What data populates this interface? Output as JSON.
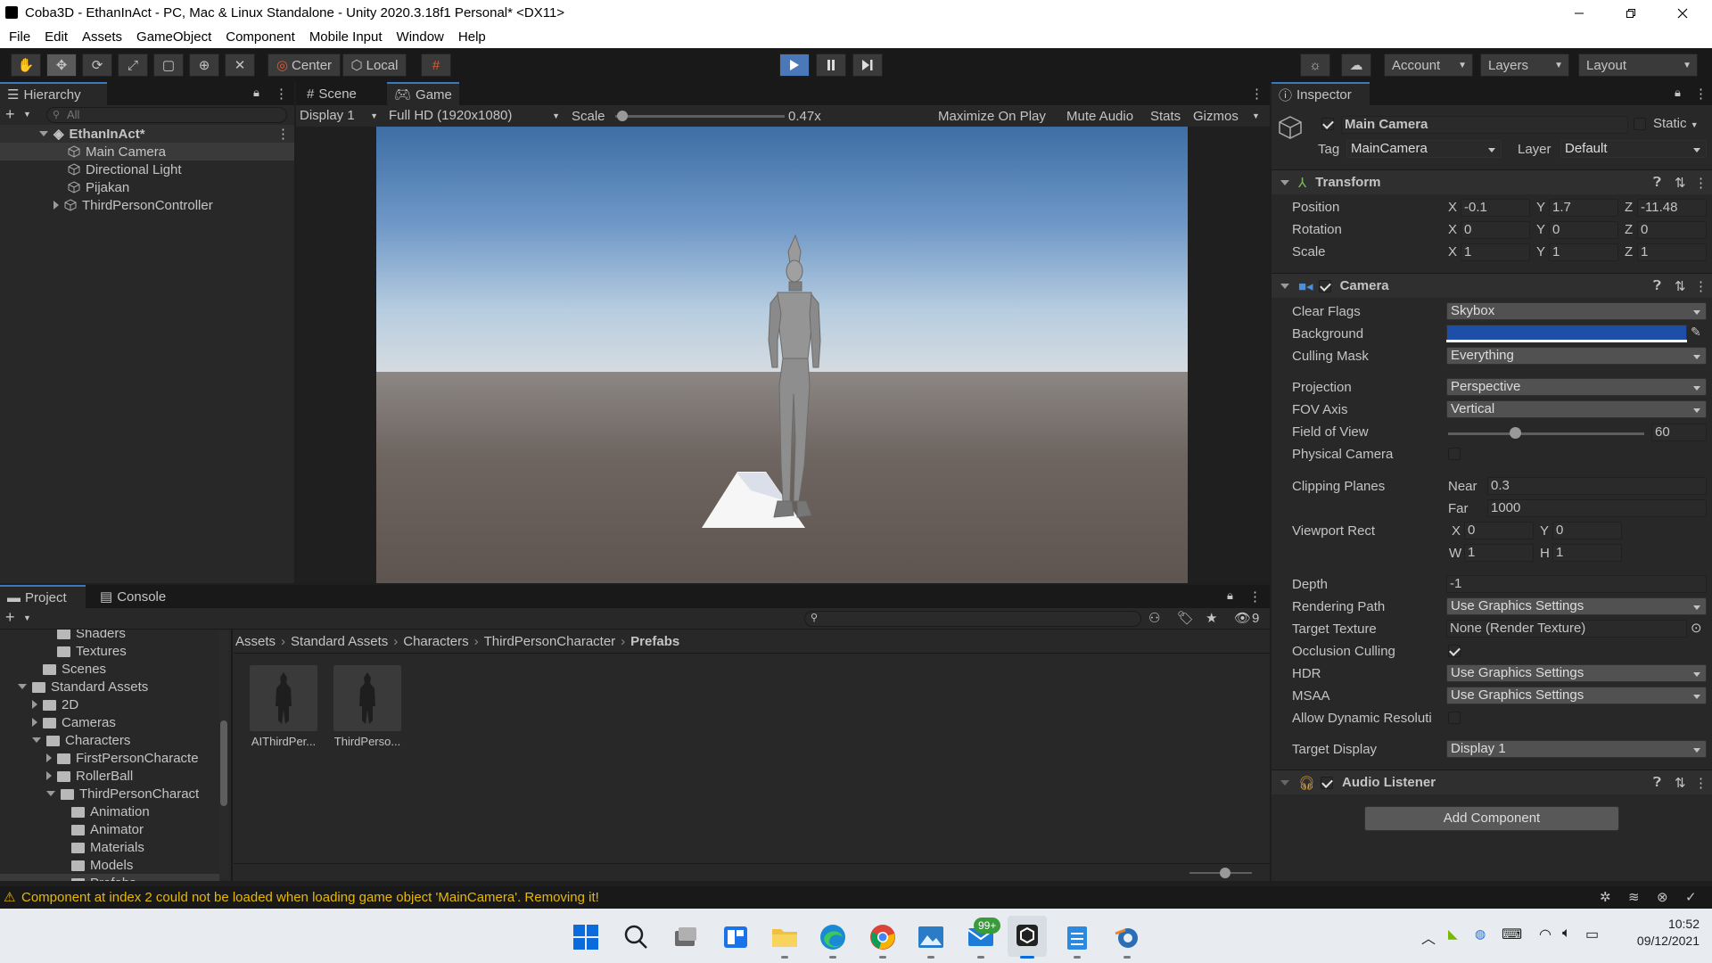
{
  "window": {
    "title": "Coba3D - EthanInAct - PC, Mac & Linux Standalone - Unity 2020.3.18f1 Personal* <DX11>"
  },
  "menu": [
    "File",
    "Edit",
    "Assets",
    "GameObject",
    "Component",
    "Mobile Input",
    "Window",
    "Help"
  ],
  "toolbar": {
    "pivot": "Center",
    "space": "Local",
    "account": "Account",
    "layers": "Layers",
    "layout": "Layout"
  },
  "hierarchy": {
    "tab": "Hierarchy",
    "search_placeholder": "All",
    "scene": "EthanInAct*",
    "items": [
      "Main Camera",
      "Directional Light",
      "Pijakan",
      "ThirdPersonController"
    ]
  },
  "view_tabs": {
    "scene": "Scene",
    "game": "Game"
  },
  "game_bar": {
    "display": "Display 1",
    "resolution": "Full HD (1920x1080)",
    "scale_label": "Scale",
    "scale_value": "0.47x",
    "maximize": "Maximize On Play",
    "mute": "Mute Audio",
    "stats": "Stats",
    "gizmos": "Gizmos"
  },
  "project": {
    "tabs": {
      "project": "Project",
      "console": "Console"
    },
    "filter_count": "9",
    "tree": [
      {
        "label": "Shaders",
        "indent": 3,
        "arrow": "none"
      },
      {
        "label": "Textures",
        "indent": 3,
        "arrow": "none"
      },
      {
        "label": "Scenes",
        "indent": 2,
        "arrow": "none"
      },
      {
        "label": "Standard Assets",
        "indent": 1,
        "arrow": "down"
      },
      {
        "label": "2D",
        "indent": 2,
        "arrow": "right"
      },
      {
        "label": "Cameras",
        "indent": 2,
        "arrow": "right"
      },
      {
        "label": "Characters",
        "indent": 2,
        "arrow": "down"
      },
      {
        "label": "FirstPersonCharacte",
        "indent": 3,
        "arrow": "right"
      },
      {
        "label": "RollerBall",
        "indent": 3,
        "arrow": "right"
      },
      {
        "label": "ThirdPersonCharact",
        "indent": 3,
        "arrow": "down"
      },
      {
        "label": "Animation",
        "indent": 4,
        "arrow": "none"
      },
      {
        "label": "Animator",
        "indent": 4,
        "arrow": "none"
      },
      {
        "label": "Materials",
        "indent": 4,
        "arrow": "none"
      },
      {
        "label": "Models",
        "indent": 4,
        "arrow": "none"
      },
      {
        "label": "Prefabs",
        "indent": 4,
        "arrow": "none"
      }
    ],
    "breadcrumb": [
      "Assets",
      "Standard Assets",
      "Characters",
      "ThirdPersonCharacter",
      "Prefabs"
    ],
    "assets": [
      "AIThirdPer...",
      "ThirdPerso..."
    ]
  },
  "inspector": {
    "tab": "Inspector",
    "object_name": "Main Camera",
    "static": "Static",
    "tag_label": "Tag",
    "tag": "MainCamera",
    "layer_label": "Layer",
    "layer": "Default",
    "transform": {
      "title": "Transform",
      "rows": [
        {
          "label": "Position",
          "x": "-0.1",
          "y": "1.7",
          "z": "-11.48"
        },
        {
          "label": "Rotation",
          "x": "0",
          "y": "0",
          "z": "0"
        },
        {
          "label": "Scale",
          "x": "1",
          "y": "1",
          "z": "1"
        }
      ]
    },
    "camera": {
      "title": "Camera",
      "clear_flags_label": "Clear Flags",
      "clear_flags": "Skybox",
      "background_label": "Background",
      "background_color": "#1e4fa8",
      "culling_mask_label": "Culling Mask",
      "culling_mask": "Everything",
      "projection_label": "Projection",
      "projection": "Perspective",
      "fov_axis_label": "FOV Axis",
      "fov_axis": "Vertical",
      "fov_label": "Field of View",
      "fov": "60",
      "physical_label": "Physical Camera",
      "clipping_label": "Clipping Planes",
      "near_label": "Near",
      "near": "0.3",
      "far_label": "Far",
      "far": "1000",
      "viewport_label": "Viewport Rect",
      "vx": "0",
      "vy": "0",
      "vw": "1",
      "vh": "1",
      "depth_label": "Depth",
      "depth": "-1",
      "rendering_path_label": "Rendering Path",
      "rendering_path": "Use Graphics Settings",
      "target_texture_label": "Target Texture",
      "target_texture": "None (Render Texture)",
      "occlusion_label": "Occlusion Culling",
      "hdr_label": "HDR",
      "hdr": "Use Graphics Settings",
      "msaa_label": "MSAA",
      "msaa": "Use Graphics Settings",
      "dynamic_res_label": "Allow Dynamic Resoluti",
      "target_display_label": "Target Display",
      "target_display": "Display 1"
    },
    "audio_listener": "Audio Listener",
    "add_component": "Add Component"
  },
  "status": {
    "warning": "Component at index 2 could not be loaded when loading game object 'MainCamera'. Removing it!"
  },
  "taskbar": {
    "time": "10:52",
    "date": "09/12/2021",
    "mail_badge": "99+"
  }
}
